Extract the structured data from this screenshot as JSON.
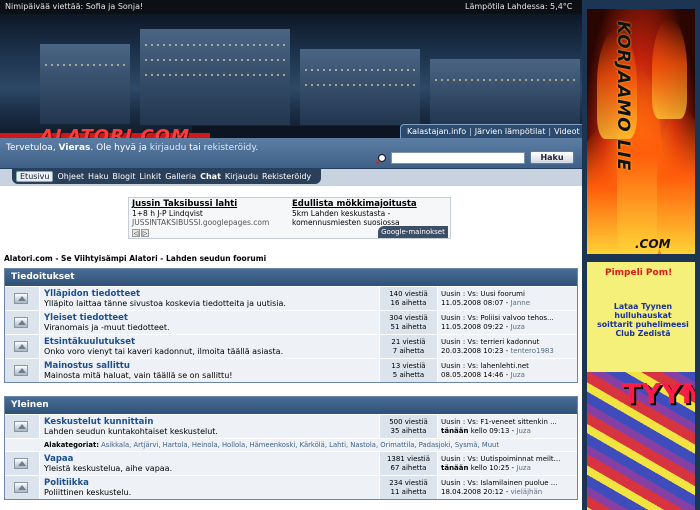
{
  "topbar": {
    "names_day": "Nimipäivää viettää: Sofia ja Sonja!",
    "temperature": "Lämpötila Lahdessa: 5,4°C"
  },
  "banner": {
    "logo": "ALATORI.COM"
  },
  "quicklinks": [
    "Kalastajan.info",
    "Järvien lämpötilat",
    "Videot"
  ],
  "welcome": {
    "prefix": "Tervetuloa, ",
    "user": "Vieras",
    "middle": ". Ole hyvä ja ",
    "login": "kirjaudu",
    "or": " tai ",
    "register": "rekisteröidy",
    "end": "."
  },
  "search": {
    "button": "Haku",
    "value": ""
  },
  "nav": [
    "Etusivu",
    "Ohjeet",
    "Haku",
    "Blogit",
    "Linkit",
    "Galleria",
    "Chat",
    "Kirjaudu",
    "Rekisteröidy"
  ],
  "ads": {
    "ad1": {
      "title": "Jussin Taksibussi lahti",
      "line1": "1+8 h J-P Lindqvist",
      "url": "JUSSINTAKSIBUSSI.googlepages.com"
    },
    "ad2": {
      "title": "Edullista mökkimajoitusta",
      "line1": "5km Lahden keskustasta -komennusmiesten suosiossa"
    },
    "badge": "Google-mainokset"
  },
  "breadcrumb": "Alatori.com - Se Viihtyisämpi Alatori - Lahden seudun foorumi",
  "categories": [
    {
      "title": "Tiedoitukset",
      "forums": [
        {
          "title": "Ylläpidon tiedotteet",
          "desc": "Ylläpito laittaa tänne sivustoa koskevia tiedotteita ja uutisia.",
          "posts": "140 viestiä",
          "topics": "16 aihetta",
          "last": "Uusin : Vs: Uusi foorumi",
          "date": "11.05.2008 08:07",
          "by": "Janne"
        },
        {
          "title": "Yleiset tiedotteet",
          "desc": "Viranomais ja -muut tiedotteet.",
          "posts": "304 viestiä",
          "topics": "51 aihetta",
          "last": "Uusin : Vs: Poliisi valvoo tehos...",
          "date": "11.05.2008 09:22",
          "by": "Juza"
        },
        {
          "title": "Etsintäkuulutukset",
          "desc": "Onko voro vienyt tai kaveri kadonnut, ilmoita täällä asiasta.",
          "posts": "21 viestiä",
          "topics": "7 aihetta",
          "last": "Uusin : Vs: terrieri kadonnut",
          "date": "20.03.2008 10:23",
          "by": "tentero1983"
        },
        {
          "title": "Mainostus sallittu",
          "desc": "Mainosta mitä haluat, vain täällä se on sallittu!",
          "posts": "13 viestiä",
          "topics": "5 aihetta",
          "last": "Uusin : Vs: lahenlehti.net",
          "date": "08.05.2008 14:46",
          "by": "Juza"
        }
      ]
    },
    {
      "title": "Yleinen",
      "forums": [
        {
          "title": "Keskustelut kunnittain",
          "desc": "Lahden seudun kuntakohtaiset keskustelut.",
          "posts": "500 viestiä",
          "topics": "35 aihetta",
          "last": "Uusin : Vs: F1-veneet sittenkin ...",
          "date": "tänään",
          "time": "kello 09:13",
          "by": "Juza"
        },
        {
          "title": "Vapaa",
          "desc": "Yleistä keskustelua, aihe vapaa.",
          "posts": "1381 viestiä",
          "topics": "67 aihetta",
          "last": "Uusin : Vs: Uutispoiminnat meilt...",
          "date": "tänään",
          "time": "kello 10:25",
          "by": "Juza"
        },
        {
          "title": "Politiikka",
          "desc": "Poliittinen keskustelu.",
          "posts": "234 viestiä",
          "topics": "11 aihetta",
          "last": "Uusin : Vs: Islamilainen puolue ...",
          "date": "18.04.2008 20:12",
          "by": "vieläjhän"
        }
      ],
      "subforums_label": "Alakategoriat:",
      "subforums": "Asikkala, Artjärvi, Hartola, Heinola, Hollola, Hämeenkoski, Kärkölä, Lahti, Nastola, Orimattila, Padasjoki, Sysmä, Muut"
    }
  ],
  "sidebar": {
    "ad_top": {
      "text": "KORJAAMO LIE",
      "suffix": ".COM"
    },
    "ad_bottom": {
      "headline": "Pimpeli Pom!",
      "body": "Lataa Tyynen hulluhauskat soittarit puhelimeesi Club Zedistä",
      "big": "TYYNE"
    }
  },
  "colors": {
    "header_blue": "#2f5177",
    "link_blue": "#1d4f8c",
    "accent_red": "#d01818",
    "page_bg": "#1f3a56"
  }
}
